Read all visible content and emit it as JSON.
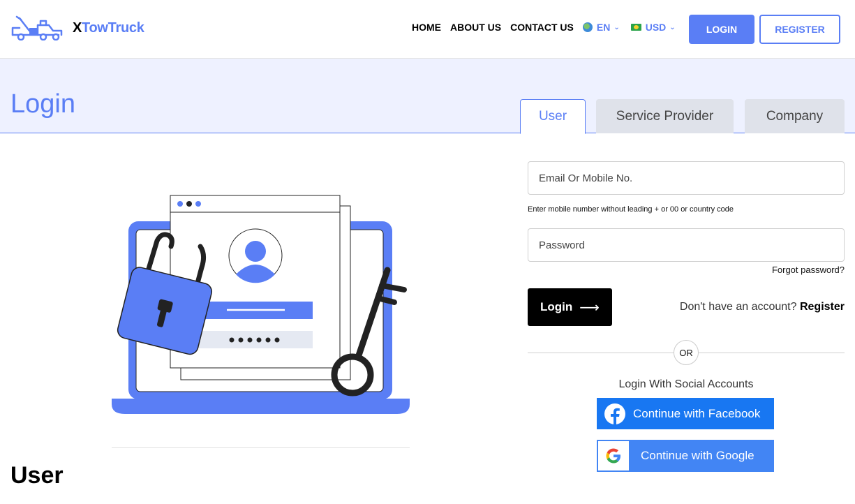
{
  "brand": {
    "name_prefix": "X",
    "name_rest": "TowTruck"
  },
  "nav": {
    "home": "HOME",
    "about": "ABOUT US",
    "contact": "CONTACT US",
    "language": "EN",
    "currency": "USD",
    "login": "LOGIN",
    "register": "REGISTER"
  },
  "page": {
    "title": "Login",
    "tabs": [
      {
        "label": "User",
        "active": true
      },
      {
        "label": "Service Provider",
        "active": false
      },
      {
        "label": "Company",
        "active": false
      }
    ],
    "section_title": "User"
  },
  "form": {
    "email_placeholder": "Email Or Mobile No.",
    "email_value": "",
    "hint": "Enter mobile number without leading + or 00 or country code",
    "password_placeholder": "Password",
    "password_value": "",
    "forgot": "Forgot password?",
    "submit": "Login",
    "no_account": "Don't have an account?",
    "register_link": "Register",
    "or": "OR",
    "social_title": "Login With Social Accounts",
    "facebook": "Continue with Facebook",
    "google": "Continue with Google"
  },
  "colors": {
    "accent": "#5a7ef5",
    "banner": "#eef1ff",
    "facebook": "#1877f2",
    "google": "#4285f4"
  }
}
